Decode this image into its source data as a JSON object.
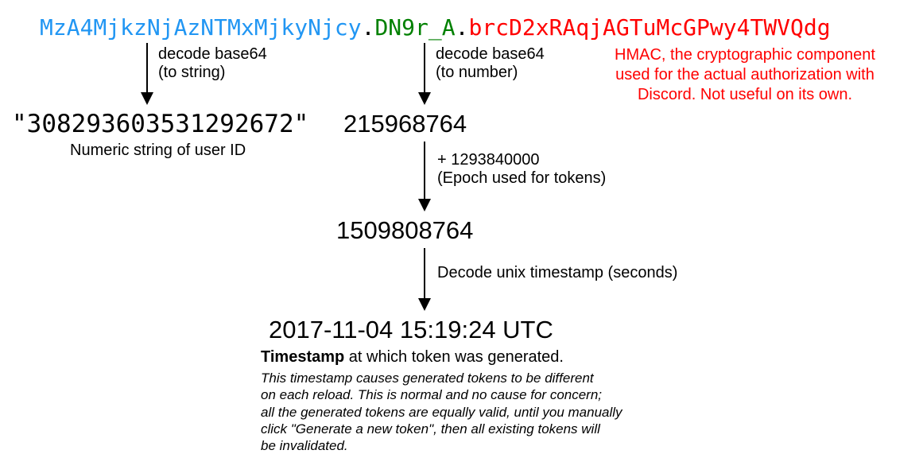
{
  "token": {
    "part1": "MzA4MjkzNjAzNTMxMjkyNjcy",
    "dot1": ".",
    "part2": "DN9r_A",
    "dot2": ".",
    "part3": "brcD2xRAqjAGTuMcGPwy4TWVQdg"
  },
  "left": {
    "arrow_label_line1": "decode base64",
    "arrow_label_line2": "(to string)",
    "user_id": "\"308293603531292672\"",
    "user_id_caption": "Numeric string of user ID"
  },
  "middle": {
    "arrow1_label_line1": "decode base64",
    "arrow1_label_line2": "(to number)",
    "decoded_number": "215968764",
    "arrow2_label_line1": "+ 1293840000",
    "arrow2_label_line2": "(Epoch used for tokens)",
    "epoch_sum": "1509808764",
    "arrow3_label": "Decode unix timestamp (seconds)",
    "timestamp": "2017-11-04 15:19:24 UTC",
    "caption_bold": "Timestamp",
    "caption_rest": " at which token was generated.",
    "italic_l1": "This timestamp causes generated tokens to be different",
    "italic_l2": "on each reload. This is normal and no cause for concern;",
    "italic_l3": "all the generated tokens are equally valid, until you manually",
    "italic_l4": "click \"Generate a new token\", then all existing tokens will",
    "italic_l5": "be invalidated."
  },
  "right": {
    "hmac_line1": "HMAC, the cryptographic component",
    "hmac_line2": "used for the actual authorization with",
    "hmac_line3": "Discord. Not useful on its own."
  }
}
